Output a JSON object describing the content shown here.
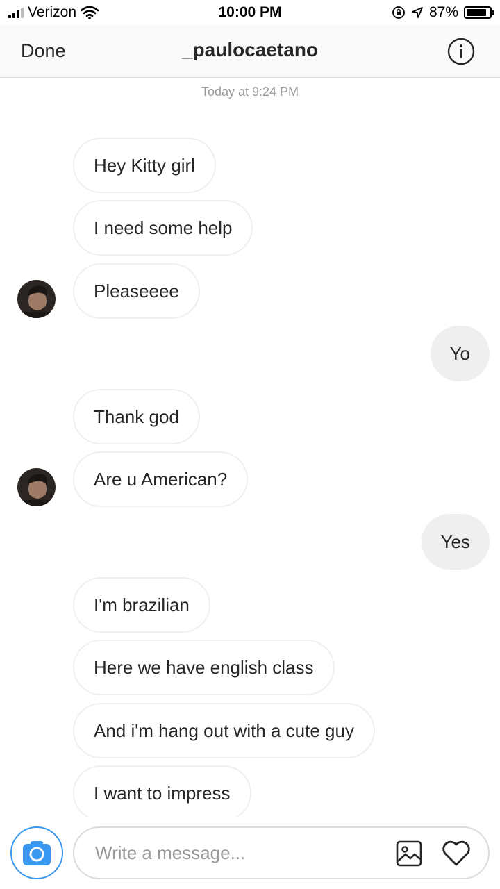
{
  "status_bar": {
    "carrier": "Verizon",
    "time": "10:00 PM",
    "battery_percent": "87%",
    "battery_level": 0.87
  },
  "header": {
    "done_label": "Done",
    "title": "_paulocaetano",
    "info_icon": "info-icon"
  },
  "conversation": {
    "timestamp": "Today at 9:24 PM",
    "messages": [
      {
        "text": "Hey Kitty girl",
        "direction": "incoming",
        "avatar": false
      },
      {
        "text": "I need some help",
        "direction": "incoming",
        "avatar": false
      },
      {
        "text": "Pleaseeee",
        "direction": "incoming",
        "avatar": true
      },
      {
        "text": "Yo",
        "direction": "outgoing",
        "avatar": false
      },
      {
        "text": "Thank god",
        "direction": "incoming",
        "avatar": false
      },
      {
        "text": "Are u American?",
        "direction": "incoming",
        "avatar": true
      },
      {
        "text": "Yes",
        "direction": "outgoing",
        "avatar": false
      },
      {
        "text": "I'm brazilian",
        "direction": "incoming",
        "avatar": false
      },
      {
        "text": "Here we have english class",
        "direction": "incoming",
        "avatar": false
      },
      {
        "text": "And i'm hang out with a cute guy",
        "direction": "incoming",
        "avatar": false
      },
      {
        "text": "I want to impress",
        "direction": "incoming",
        "avatar": false
      }
    ]
  },
  "composer": {
    "placeholder": "Write a message...",
    "camera_icon": "camera-icon",
    "gallery_icon": "gallery-icon",
    "like_icon": "heart-icon"
  },
  "colors": {
    "accent": "#3897f0",
    "outgoing_bubble": "#efefef",
    "incoming_border": "#efefef",
    "muted_text": "#999999"
  }
}
